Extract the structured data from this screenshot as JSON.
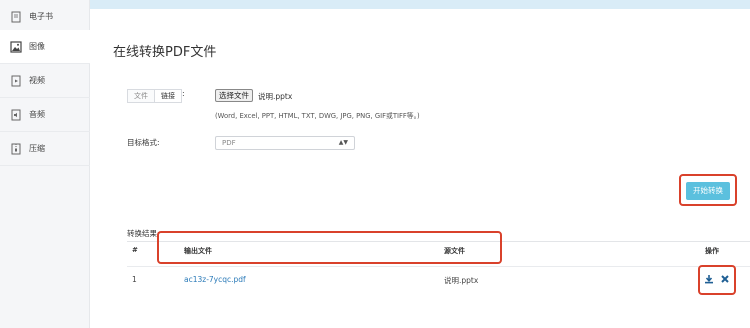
{
  "sidebar": {
    "items": [
      {
        "label": "电子书",
        "icon": "book-icon"
      },
      {
        "label": "图像",
        "icon": "image-icon"
      },
      {
        "label": "视频",
        "icon": "video-icon"
      },
      {
        "label": "音频",
        "icon": "audio-icon"
      },
      {
        "label": "压缩",
        "icon": "archive-icon"
      }
    ],
    "active_index": 1
  },
  "page": {
    "title": "在线转换PDF文件"
  },
  "source": {
    "tabs": [
      "文件",
      "链接"
    ],
    "colon": ":",
    "choose_file_label": "选择文件",
    "file_name": "说明.pptx",
    "hint": "(Word, Excel, PPT, HTML, TXT, DWG, JPG, PNG, GIF或TIFF等。)"
  },
  "target": {
    "label": "目标格式:",
    "selected": "PDF"
  },
  "actions": {
    "start_label": "开始转换"
  },
  "results": {
    "label": "转换结果:",
    "columns": [
      "#",
      "输出文件",
      "源文件",
      "操作"
    ],
    "rows": [
      {
        "index": "1",
        "output": "ac13z-7ycqc.pdf",
        "source": "说明.pptx"
      }
    ]
  },
  "colors": {
    "accent": "#5bc0de",
    "highlight": "#d9412b",
    "link": "#2a7ab8"
  }
}
